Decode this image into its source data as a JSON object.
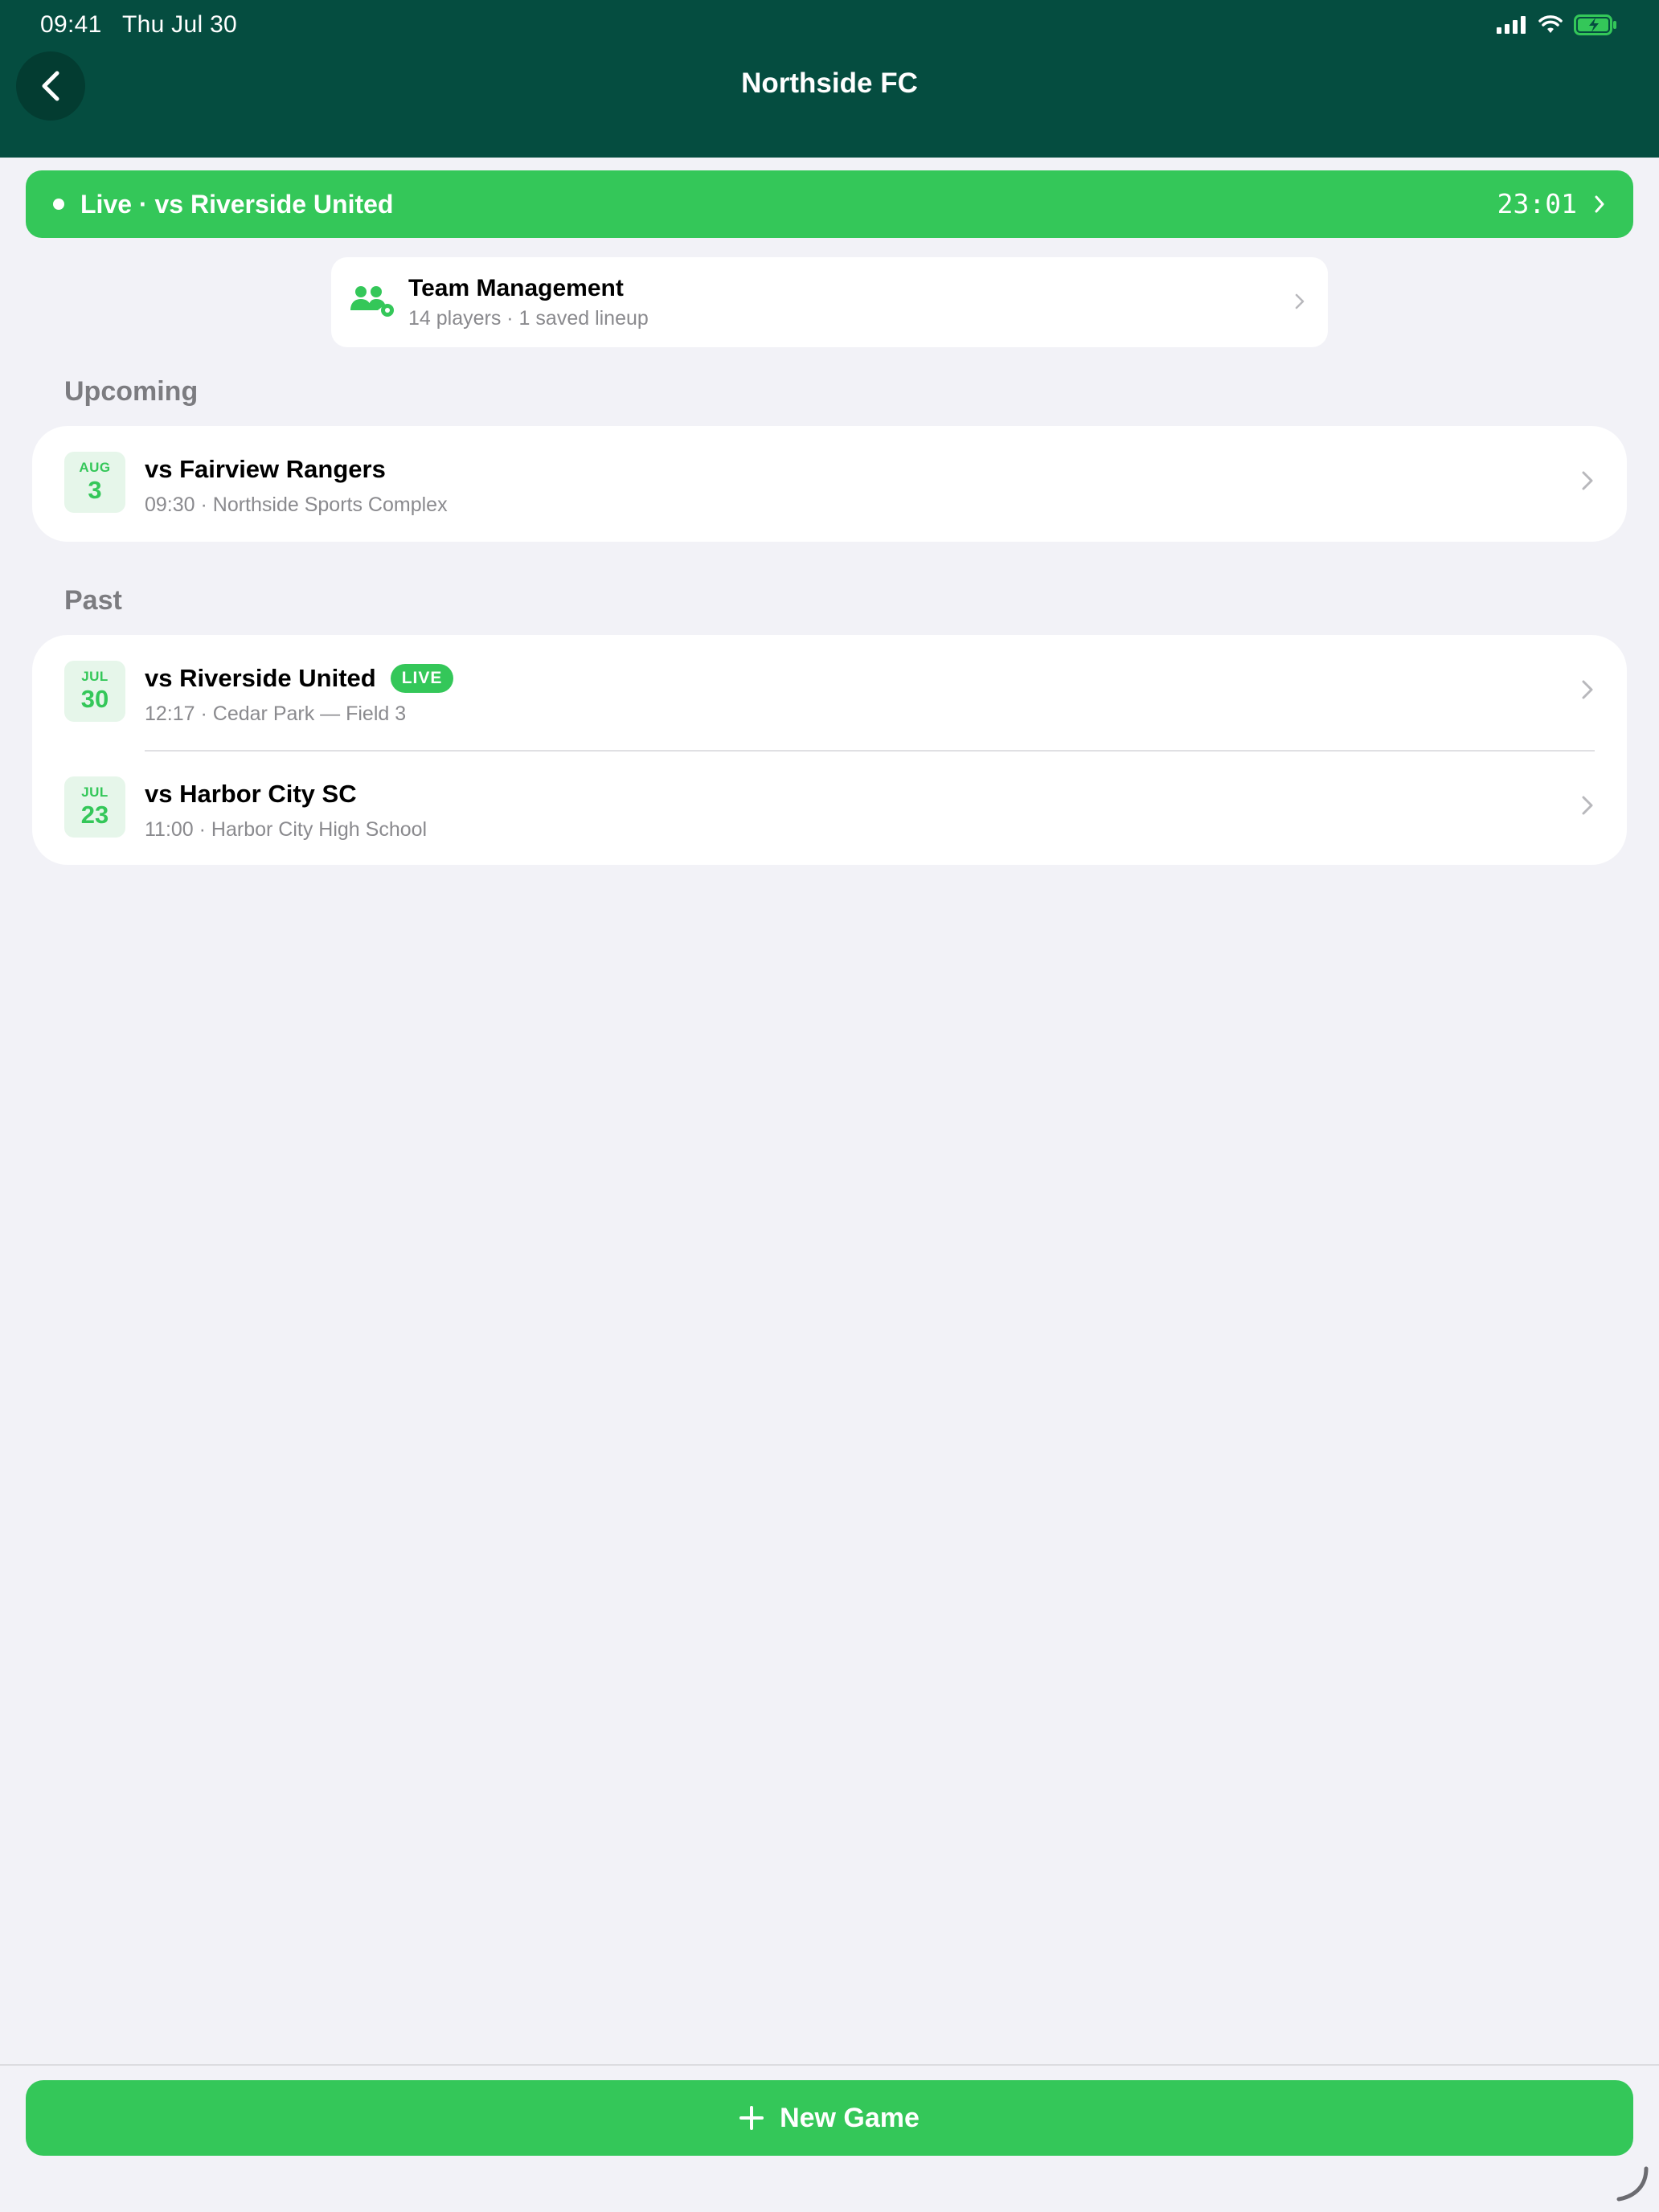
{
  "status_bar": {
    "time": "09:41",
    "date": "Thu Jul 30"
  },
  "header": {
    "title": "Northside FC"
  },
  "live_banner": {
    "label": "Live · vs Riverside United",
    "timer": "23:01"
  },
  "team_management": {
    "title": "Team Management",
    "subtitle": "14 players · 1 saved lineup"
  },
  "sections": {
    "upcoming": {
      "title": "Upcoming",
      "games": [
        {
          "month": "AUG",
          "day": "3",
          "title": "vs Fairview Rangers",
          "subtitle": "09:30 · Northside Sports Complex"
        }
      ]
    },
    "past": {
      "title": "Past",
      "games": [
        {
          "month": "JUL",
          "day": "30",
          "title": "vs Riverside United",
          "badge": "LIVE",
          "subtitle": "12:17 · Cedar Park — Field 3"
        },
        {
          "month": "JUL",
          "day": "23",
          "title": "vs Harbor City SC",
          "subtitle": "11:00 · Harbor City High School"
        }
      ]
    }
  },
  "footer": {
    "new_game_label": "New Game"
  },
  "colors": {
    "header_bg": "#054d40",
    "accent": "#34c759",
    "background": "#f2f2f7"
  }
}
